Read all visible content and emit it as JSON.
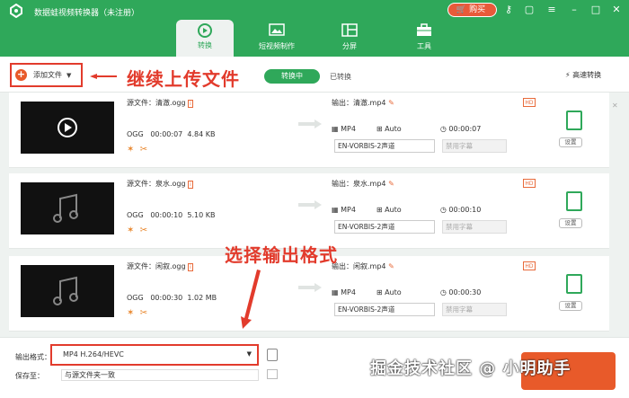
{
  "app": {
    "title": "数据蛙视频转换器（未注册）",
    "buy_label": "购买"
  },
  "tabs": [
    {
      "label": "转换"
    },
    {
      "label": "短视频制作"
    },
    {
      "label": "分屏"
    },
    {
      "label": "工具"
    }
  ],
  "toolbar": {
    "add_label": "添加文件",
    "annotation": "继续上传文件",
    "converting": "转换中",
    "converted": "已转换",
    "fast": "高速转换"
  },
  "rows": [
    {
      "source": "源文件：清澈.ogg",
      "format": "OGG",
      "duration": "00:00:07",
      "size": "4.84 KB",
      "output": "输出：清澈.mp4",
      "out_format": "MP4",
      "res": "Auto",
      "out_duration": "00:00:07",
      "audio": "EN-VORBIS-2声道",
      "subtitle": "禁用字幕",
      "settings": "设置"
    },
    {
      "source": "源文件：泉水.ogg",
      "format": "OGG",
      "duration": "00:00:10",
      "size": "5.10 KB",
      "output": "输出：泉水.mp4",
      "out_format": "MP4",
      "res": "Auto",
      "out_duration": "00:00:10",
      "audio": "EN-VORBIS-2声道",
      "subtitle": "禁用字幕",
      "settings": "设置"
    },
    {
      "source": "源文件：闲叙.ogg",
      "format": "OGG",
      "duration": "00:00:30",
      "size": "1.02 MB",
      "output": "输出：闲叙.mp4",
      "out_format": "MP4",
      "res": "Auto",
      "out_duration": "00:00:30",
      "audio": "EN-VORBIS-2声道",
      "subtitle": "禁用字幕",
      "settings": "设置"
    }
  ],
  "footer": {
    "format_label": "输出格式：",
    "format_value": "MP4 H.264/HEVC",
    "save_label": "保存至：",
    "save_value": "与源文件夹一致",
    "annotation": "选择输出格式",
    "watermark": "掘金技术社区 @ 小明助手"
  },
  "colors": {
    "brand": "#2fa85a",
    "accent": "#e85a2a",
    "annotation": "#e23b2c"
  }
}
